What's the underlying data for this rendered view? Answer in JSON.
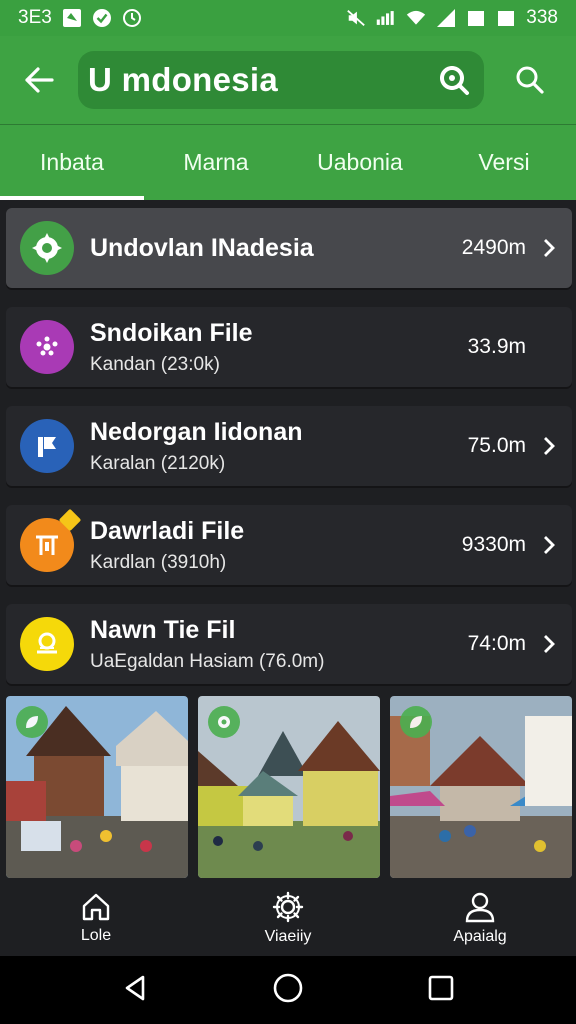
{
  "status_bar": {
    "left_text": "3E3",
    "time": "338"
  },
  "app_bar": {
    "title": "U mdonesia"
  },
  "tabs": [
    {
      "label": "Inbata",
      "active": true
    },
    {
      "label": "Marna",
      "active": false
    },
    {
      "label": "Uabonia",
      "active": false
    },
    {
      "label": "Versi",
      "active": false
    }
  ],
  "list": [
    {
      "name": "Undovlan INadesia",
      "subtitle": "",
      "size": "2490m",
      "icon": "gear-badge-icon",
      "color": "#43a047",
      "chevron": true
    },
    {
      "name": "Sndoikan File",
      "subtitle": "Kandan (23:0k)",
      "size": "33.9m",
      "icon": "dots-icon",
      "color": "#a93ab5",
      "chevron": false
    },
    {
      "name": "Nedorgan Iidonan",
      "subtitle": "Karalan (2120k)",
      "size": "75.0m",
      "icon": "flag-icon",
      "color": "#2962b8",
      "chevron": true
    },
    {
      "name": "Dawrladi File",
      "subtitle": "Kardlan (3910h)",
      "size": "9330m",
      "icon": "gate-icon",
      "color": "#f28a1b",
      "chevron": true
    },
    {
      "name": "Nawn Tie Fil",
      "subtitle": "UaEgaldan Hasiam (76.0m)",
      "size": "74:0m",
      "icon": "crown-icon",
      "color": "#f5d90a",
      "chevron": true
    }
  ],
  "gallery": [
    {
      "icon": "leaf-icon"
    },
    {
      "icon": "flower-icon"
    },
    {
      "icon": "leaf-icon"
    }
  ],
  "bottom_nav": [
    {
      "label": "Lole",
      "icon": "home-icon"
    },
    {
      "label": "Viaeiiy",
      "icon": "gear-icon"
    },
    {
      "label": "Apaialg",
      "icon": "person-icon"
    }
  ],
  "colors": {
    "accent_green": "#3ea343",
    "background": "#1e1f22"
  }
}
